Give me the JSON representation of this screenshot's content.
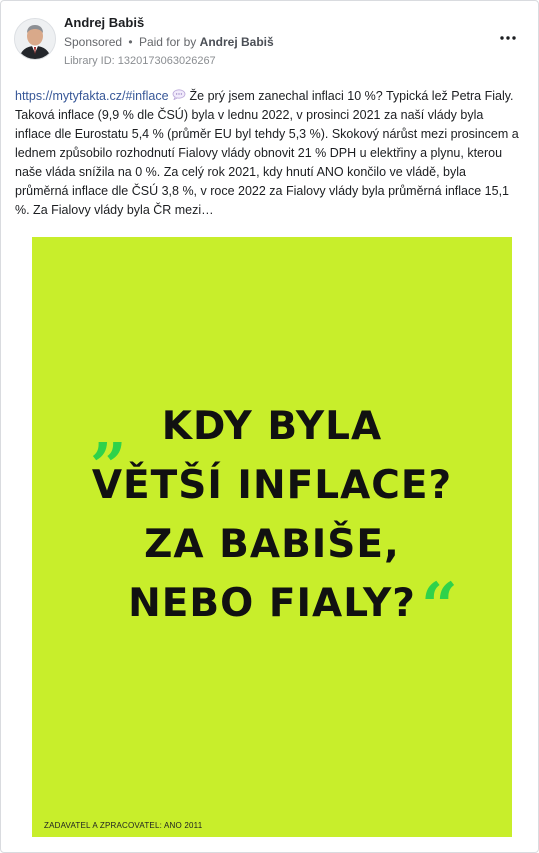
{
  "post": {
    "author": "Andrej Babiš",
    "sponsored_label": "Sponsored",
    "separator": "•",
    "paid_for_prefix": "Paid for by",
    "paid_for_name": "Andrej Babiš",
    "library_id": "Library ID: 1320173063026267",
    "more_options_icon": "more-horizontal-icon",
    "link_text": "https://mytyfakta.cz/#inflace",
    "bubble_icon": "speech-bubble-icon",
    "text": "Že prý jsem zanechal inflaci 10 %? Typická lež Petra Fialy. Taková inflace (9,9 % dle ČSÚ) byla v lednu 2022, v prosinci 2021 za naší vlády byla inflace dle Eurostatu 5,4 % (průměr EU byl tehdy 5,3 %). Skokový nárůst mezi prosincem a lednem způsobilo rozhodnutí Fialovy vlády obnovit 21 % DPH u elektřiny a plynu, kterou naše vláda snížila na 0 %. Za celý rok 2021, kdy hnutí ANO končilo ve vládě, byla průměrná inflace dle ČSÚ 3,8 %, v roce 2022 za Fialovy vlády byla průměrná inflace 15,1 %. Za Fialovy vlády byla ČR mezi…"
  },
  "creative": {
    "background_color": "#c8ee2b",
    "quote_color": "#2fd24a",
    "quote_open": "„",
    "quote_close": "“",
    "headline_lines": [
      "KDY BYLA",
      "VĚTŠÍ INFLACE?",
      "ZA BABIŠE,",
      "NEBO FIALY?"
    ],
    "footer": "ZADAVATEL A ZPRACOVATEL: ANO 2011"
  }
}
